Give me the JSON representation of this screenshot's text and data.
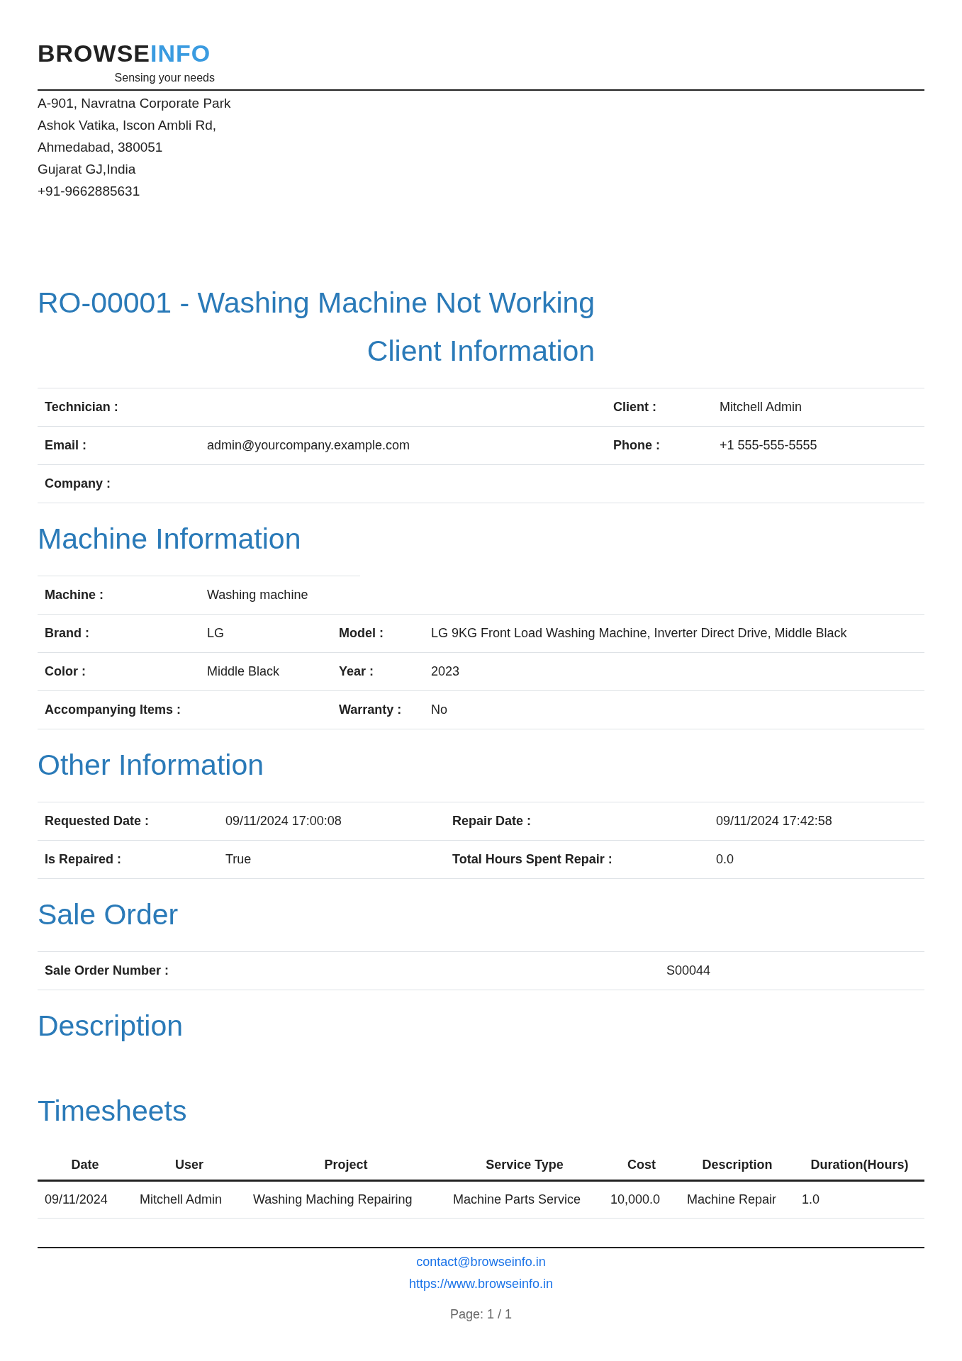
{
  "company": {
    "logo_dark": "BROWSE",
    "logo_light": "INFO",
    "tagline": "Sensing your needs",
    "address": [
      "A-901, Navratna Corporate Park",
      "Ashok Vatika, Iscon Ambli Rd,",
      "Ahmedabad, 380051",
      "Gujarat GJ,India",
      "+91-9662885631"
    ]
  },
  "title": "RO-00001 - Washing Machine Not Working",
  "sections": [
    {
      "title": "Client Information",
      "kind": "fields",
      "rows": [
        [
          {
            "label": "Technician :"
          },
          {
            "label": "Client :",
            "value": "Mitchell Admin"
          }
        ],
        [
          {
            "label": "Email :",
            "value": "admin@yourcompany.example.com"
          },
          {
            "label": "Phone :",
            "value": "+1 555-555-5555"
          }
        ],
        [
          {
            "label": "Company :"
          }
        ]
      ]
    },
    {
      "title": "Machine Information",
      "kind": "fields",
      "rows": [
        [
          {
            "label": "Machine :",
            "value": "Washing machine"
          }
        ],
        [
          {
            "label": "Brand :",
            "value": "LG"
          },
          {
            "label": "Model :",
            "value": "LG 9KG Front Load Washing Machine, Inverter Direct Drive, Middle Black"
          }
        ],
        [
          {
            "label": "Color :",
            "value": "Middle Black"
          },
          {
            "label": "Year :",
            "value": "2023"
          }
        ],
        [
          {
            "label": "Accompanying Items :"
          },
          {
            "label": "Warranty :",
            "value": "No"
          }
        ]
      ]
    },
    {
      "title": "Other Information",
      "kind": "fields",
      "rows": [
        [
          {
            "label": "Requested Date :",
            "value": "09/11/2024 17:00:08"
          },
          {
            "label": "Repair Date :",
            "value": "09/11/2024 17:42:58"
          }
        ],
        [
          {
            "label": "Is Repaired :",
            "value": "True"
          },
          {
            "label": "Total Hours Spent Repair :",
            "value": "0.0"
          }
        ]
      ]
    },
    {
      "title": "Sale Order",
      "kind": "fields",
      "rows": [
        [
          {
            "label": "Sale Order Number :",
            "value": "S00044"
          }
        ]
      ]
    },
    {
      "title": "Description",
      "kind": "empty"
    },
    {
      "title": "Timesheets",
      "kind": "table",
      "columns": [
        "Date",
        "User",
        "Project",
        "Service Type",
        "Cost",
        "Description",
        "Duration(Hours)"
      ],
      "rows": [
        [
          "09/11/2024",
          "Mitchell Admin",
          "Washing Maching Repairing",
          "Machine Parts Service",
          "10,000.0",
          "Machine Repair",
          "1.0"
        ]
      ]
    }
  ],
  "footer": {
    "email": "contact@browseinfo.in",
    "website": "https://www.browseinfo.in",
    "page": "Page: 1 / 1"
  }
}
